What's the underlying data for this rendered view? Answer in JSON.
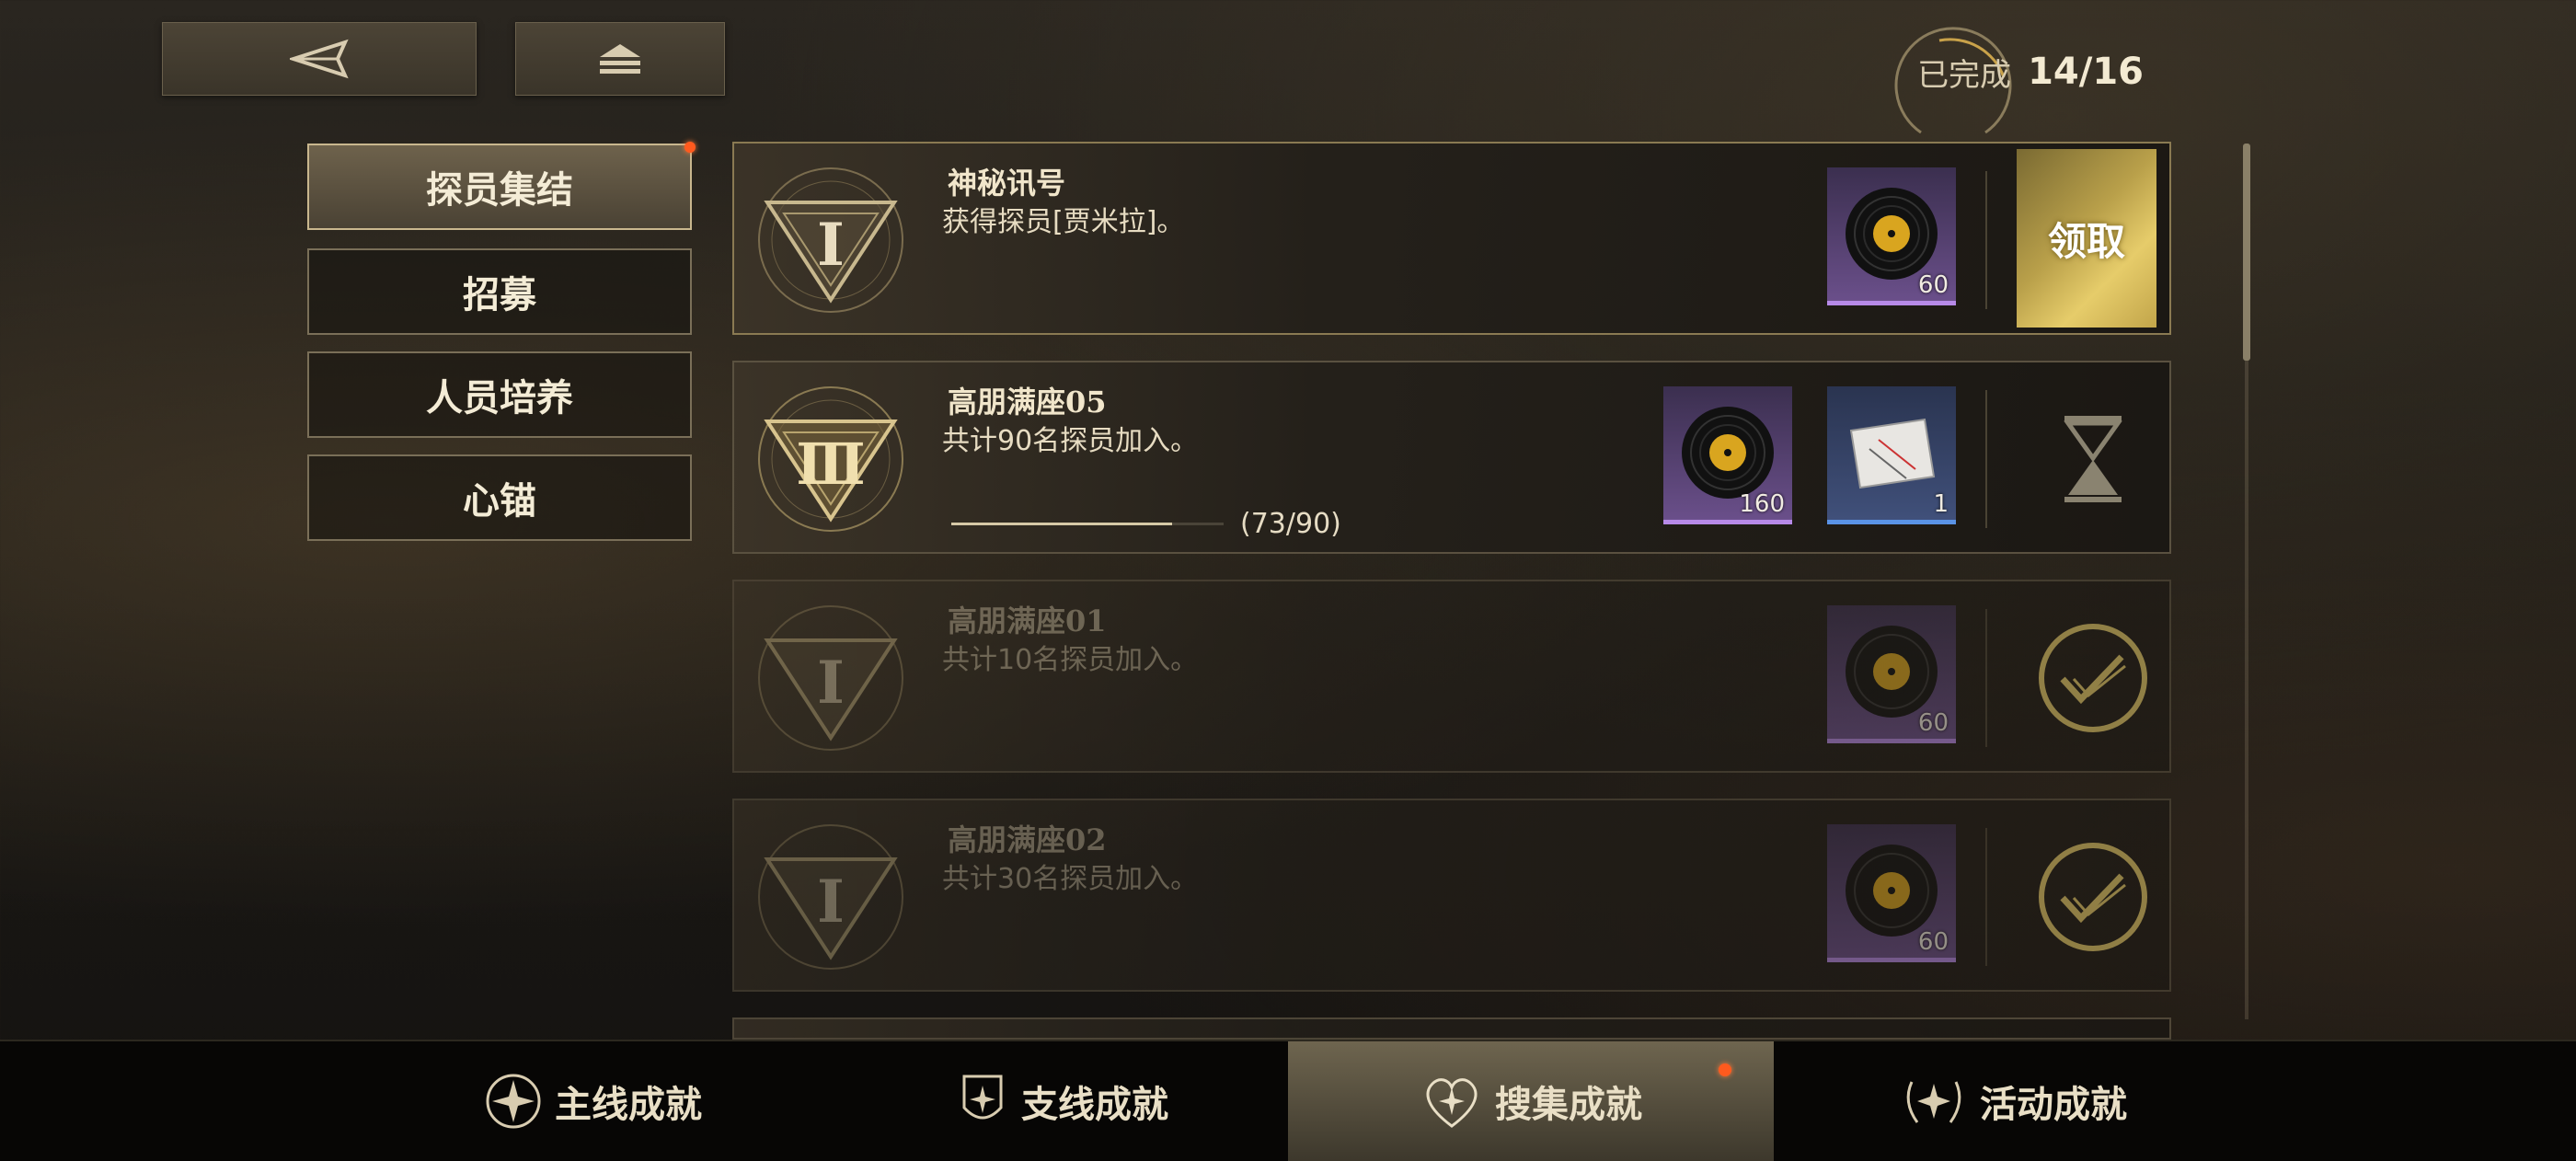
{
  "top": {
    "back_label": "back",
    "home_label": "home"
  },
  "completion": {
    "label": "已完成",
    "value": "14/16"
  },
  "sidebar": {
    "items": [
      {
        "label": "探员集结",
        "active": true,
        "notify": true
      },
      {
        "label": "招募",
        "active": false
      },
      {
        "label": "人员培养",
        "active": false
      },
      {
        "label": "心锚",
        "active": false
      }
    ]
  },
  "achievements": [
    {
      "emblem": "Ⅰ",
      "title": "神秘讯号",
      "desc": "获得探员[贾米拉]。",
      "status": "claimable",
      "action_label": "领取",
      "rewards": [
        {
          "icon": "vinyl-record-icon",
          "count": "60",
          "rarity": "purple"
        }
      ]
    },
    {
      "emblem": "Ⅲ",
      "title": "高朋满座05",
      "desc": "共计90名探员加入。",
      "status": "in-progress",
      "progress": {
        "current": 73,
        "total": 90,
        "text": "(73/90)"
      },
      "rewards": [
        {
          "icon": "vinyl-record-icon",
          "count": "160",
          "rarity": "purple"
        },
        {
          "icon": "card-item-icon",
          "count": "1",
          "rarity": "blue"
        }
      ]
    },
    {
      "emblem": "Ⅰ",
      "title": "高朋满座01",
      "desc": "共计10名探员加入。",
      "status": "completed",
      "rewards": [
        {
          "icon": "vinyl-record-icon",
          "count": "60",
          "rarity": "purple"
        }
      ]
    },
    {
      "emblem": "Ⅰ",
      "title": "高朋满座02",
      "desc": "共计30名探员加入。",
      "status": "completed",
      "rewards": [
        {
          "icon": "vinyl-record-icon",
          "count": "60",
          "rarity": "purple"
        }
      ]
    }
  ],
  "bottom_tabs": [
    {
      "label": "主线成就",
      "icon": "compass-star-icon",
      "active": false
    },
    {
      "label": "支线成就",
      "icon": "shield-star-icon",
      "active": false
    },
    {
      "label": "搜集成就",
      "icon": "heart-star-icon",
      "active": true,
      "notify": true
    },
    {
      "label": "活动成就",
      "icon": "laurel-star-icon",
      "active": false
    }
  ],
  "colors": {
    "accent_gold": "#e6cc6a",
    "notify_dot": "#ff5a1e",
    "rarity_purple": "#b78ae8",
    "rarity_blue": "#5a93e6"
  }
}
